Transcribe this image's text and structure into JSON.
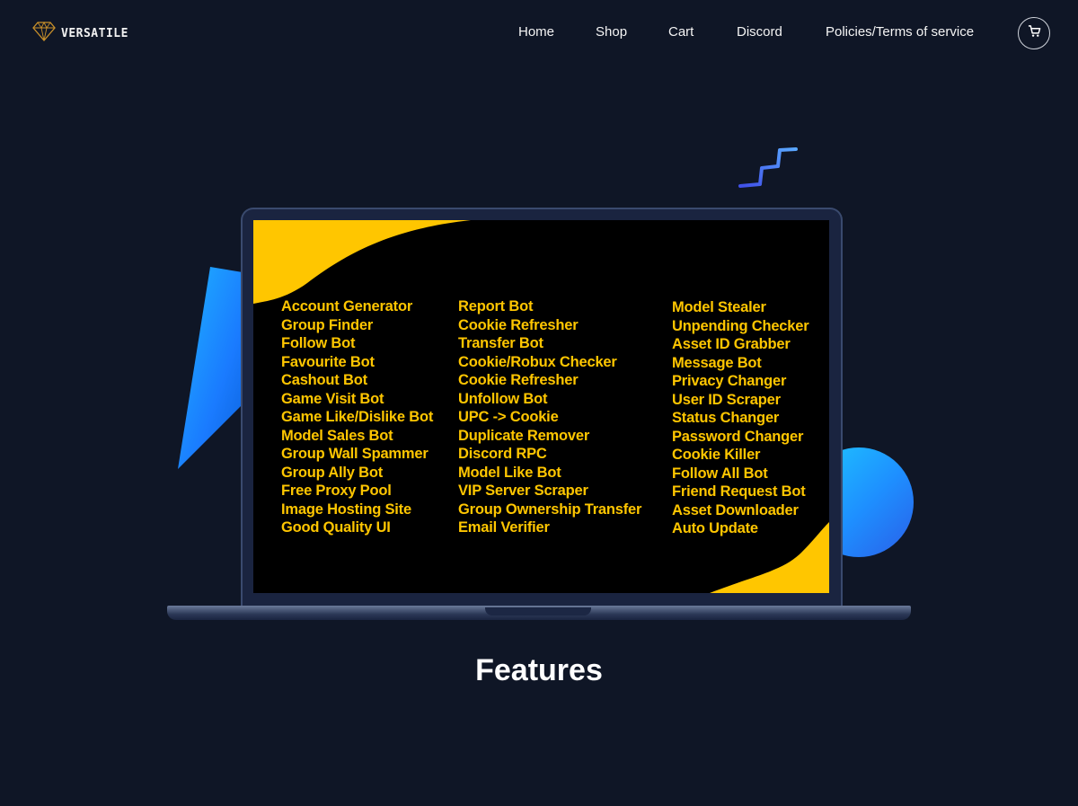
{
  "brand": {
    "name": "VERSATILE",
    "logo_icon": "diamond-icon"
  },
  "nav": {
    "items": [
      {
        "label": "Home"
      },
      {
        "label": "Shop"
      },
      {
        "label": "Cart"
      },
      {
        "label": "Discord"
      },
      {
        "label": "Policies/Terms of service"
      }
    ],
    "cart_icon": "cart-icon"
  },
  "colors": {
    "background": "#0f1626",
    "accent_yellow": "#ffc600",
    "accent_blue": "#1e8fff"
  },
  "features": {
    "columns": [
      [
        "Account Generator",
        "Group Finder",
        "Follow Bot",
        "Favourite Bot",
        "Cashout Bot",
        "Game Visit Bot",
        "Game Like/Dislike Bot",
        "Model Sales Bot",
        "Group Wall Spammer",
        "Group Ally Bot",
        "Free Proxy Pool",
        "Image Hosting Site",
        "Good Quality UI"
      ],
      [
        "Report Bot",
        "Cookie Refresher",
        "Transfer Bot",
        "Cookie/Robux Checker",
        "Cookie Refresher",
        "Unfollow Bot",
        "UPC -> Cookie",
        "Duplicate Remover",
        "Discord RPC",
        "Model Like Bot",
        "VIP Server Scraper",
        "Group Ownership Transfer",
        "Email Verifier"
      ],
      [
        "Model Stealer",
        "Unpending Checker",
        "Asset ID Grabber",
        "Message Bot",
        "Privacy Changer",
        "User ID Scraper",
        "Status Changer",
        "Password Changer",
        "Cookie Killer",
        "Follow All Bot",
        "Friend Request Bot",
        "Asset Downloader",
        "Auto Update"
      ]
    ]
  },
  "section": {
    "heading": "Features"
  }
}
